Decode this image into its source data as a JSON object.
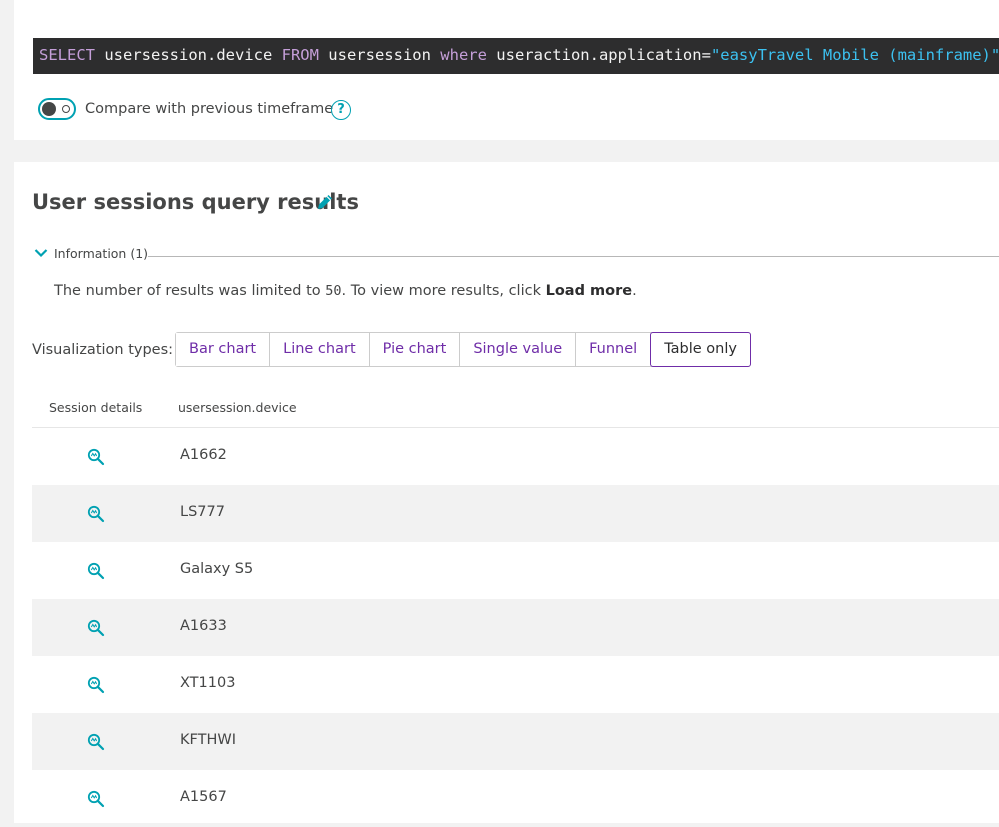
{
  "query": {
    "tokens": [
      {
        "text": "SELECT",
        "kind": "kw"
      },
      {
        "text": " usersession.device ",
        "kind": "txt"
      },
      {
        "text": "FROM",
        "kind": "kw"
      },
      {
        "text": " usersession ",
        "kind": "txt"
      },
      {
        "text": "where",
        "kind": "kw"
      },
      {
        "text": " useraction.application=",
        "kind": "txt"
      },
      {
        "text": "\"easyTravel Mobile (mainframe)\"",
        "kind": "str"
      }
    ],
    "compare_label": "Compare with previous timeframe",
    "compare_enabled": false,
    "help_symbol": "?"
  },
  "results": {
    "title": "User sessions query results",
    "edit_icon": "pencil-icon",
    "info": {
      "label": "Information (1)",
      "text_before": "The number of results was limited to ",
      "limit": "50",
      "text_middle": ". To view more results, click ",
      "link": "Load more",
      "text_after": "."
    },
    "viz": {
      "label": "Visualization types:",
      "options": [
        "Bar chart",
        "Line chart",
        "Pie chart",
        "Single value",
        "Funnel",
        "Table only"
      ],
      "selected": "Table only"
    },
    "table": {
      "columns": [
        "Session details",
        "usersession.device"
      ],
      "detail_icon": "magnifier-session-icon",
      "rows": [
        "A1662",
        "LS777",
        "Galaxy S5",
        "A1633",
        "XT1103",
        "KFTHWI",
        "A1567"
      ]
    }
  },
  "colors": {
    "accent_teal": "#00a1b2",
    "accent_purple": "#6f2da8",
    "query_bg": "#2d2d2e",
    "keyword": "#c59fd9",
    "string": "#3cc1f0",
    "row_alt": "#f2f2f2"
  }
}
